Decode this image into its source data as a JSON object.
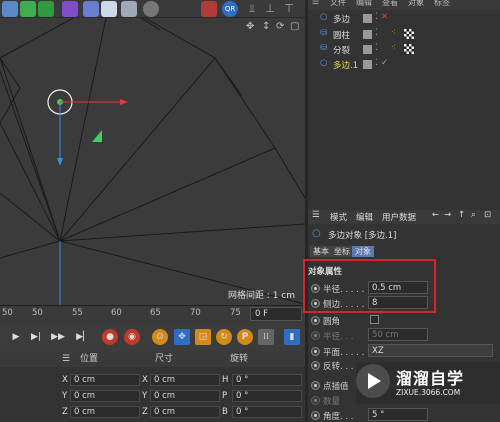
{
  "menu": {
    "file": "文件",
    "edit": "编辑",
    "view": "查看",
    "object": "对象",
    "tags": "标签"
  },
  "objects": [
    {
      "name": "多边",
      "check": "✕",
      "check_color": "#e04040"
    },
    {
      "name": "圆柱",
      "check": "",
      "check_color": "#aaa"
    },
    {
      "name": "分裂",
      "check": "",
      "check_color": "#aaa"
    },
    {
      "name": "多边.1",
      "check": "✓",
      "check_color": "#5fd05f",
      "selected": true
    }
  ],
  "viewport": {
    "grid_spacing_label": "网格间距 : 1 cm"
  },
  "timeline": {
    "ticks": [
      "50",
      "55",
      "60",
      "65",
      "70",
      "75"
    ],
    "current_frame": "0 F"
  },
  "coord": {
    "headers": [
      "位置",
      "尺寸",
      "旋转"
    ],
    "rows": [
      {
        "axis": "X",
        "pos": "0 cm",
        "size": "0 cm",
        "rot_axis": "H",
        "rot": "0 °"
      },
      {
        "axis": "Y",
        "pos": "0 cm",
        "size": "0 cm",
        "rot_axis": "P",
        "rot": "0 °"
      },
      {
        "axis": "Z",
        "pos": "0 cm",
        "size": "0 cm",
        "rot_axis": "B",
        "rot": "0 °"
      }
    ]
  },
  "attributes": {
    "menu": {
      "mode": "模式",
      "edit": "编辑",
      "user_data": "用户数据"
    },
    "object_title": "多边对象 [多边.1]",
    "tabs": [
      "基本",
      "坐标",
      "对象"
    ],
    "section_title": "对象属性",
    "radius_label": "半径. . . . .",
    "radius_value": "0.5 cm",
    "sides_label": "侧边. . . . .",
    "sides_value": "8",
    "circle_label": "圆角",
    "circle_radius_label": "半径. . .",
    "circle_radius_value": "50 cm",
    "plane_label": "平面. . . . .",
    "plane_value": "XZ",
    "reverse_label": "反转. . .",
    "point_interp_label": "点插值",
    "count_label": "数量",
    "angle_label": "角度. . .",
    "angle_value": "5 °"
  },
  "watermark": {
    "cn": "溜溜自学",
    "url": "ZIXUE.3066.COM"
  },
  "colors": {
    "accent_red": "#d8232a",
    "axis_x": "#e33a3a",
    "axis_y": "#3a8fe0",
    "axis_z": "#3ad05a",
    "selected_object": "#f3d34a"
  }
}
